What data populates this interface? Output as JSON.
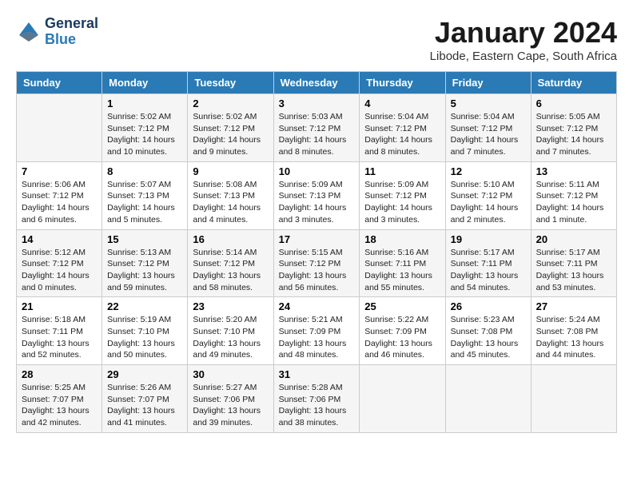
{
  "logo": {
    "text_general": "General",
    "text_blue": "Blue"
  },
  "title": "January 2024",
  "subtitle": "Libode, Eastern Cape, South Africa",
  "days_header": [
    "Sunday",
    "Monday",
    "Tuesday",
    "Wednesday",
    "Thursday",
    "Friday",
    "Saturday"
  ],
  "weeks": [
    [
      {
        "day": "",
        "sunrise": "",
        "sunset": "",
        "daylight": ""
      },
      {
        "day": "1",
        "sunrise": "Sunrise: 5:02 AM",
        "sunset": "Sunset: 7:12 PM",
        "daylight": "Daylight: 14 hours and 10 minutes."
      },
      {
        "day": "2",
        "sunrise": "Sunrise: 5:02 AM",
        "sunset": "Sunset: 7:12 PM",
        "daylight": "Daylight: 14 hours and 9 minutes."
      },
      {
        "day": "3",
        "sunrise": "Sunrise: 5:03 AM",
        "sunset": "Sunset: 7:12 PM",
        "daylight": "Daylight: 14 hours and 8 minutes."
      },
      {
        "day": "4",
        "sunrise": "Sunrise: 5:04 AM",
        "sunset": "Sunset: 7:12 PM",
        "daylight": "Daylight: 14 hours and 8 minutes."
      },
      {
        "day": "5",
        "sunrise": "Sunrise: 5:04 AM",
        "sunset": "Sunset: 7:12 PM",
        "daylight": "Daylight: 14 hours and 7 minutes."
      },
      {
        "day": "6",
        "sunrise": "Sunrise: 5:05 AM",
        "sunset": "Sunset: 7:12 PM",
        "daylight": "Daylight: 14 hours and 7 minutes."
      }
    ],
    [
      {
        "day": "7",
        "sunrise": "Sunrise: 5:06 AM",
        "sunset": "Sunset: 7:12 PM",
        "daylight": "Daylight: 14 hours and 6 minutes."
      },
      {
        "day": "8",
        "sunrise": "Sunrise: 5:07 AM",
        "sunset": "Sunset: 7:13 PM",
        "daylight": "Daylight: 14 hours and 5 minutes."
      },
      {
        "day": "9",
        "sunrise": "Sunrise: 5:08 AM",
        "sunset": "Sunset: 7:13 PM",
        "daylight": "Daylight: 14 hours and 4 minutes."
      },
      {
        "day": "10",
        "sunrise": "Sunrise: 5:09 AM",
        "sunset": "Sunset: 7:13 PM",
        "daylight": "Daylight: 14 hours and 3 minutes."
      },
      {
        "day": "11",
        "sunrise": "Sunrise: 5:09 AM",
        "sunset": "Sunset: 7:12 PM",
        "daylight": "Daylight: 14 hours and 3 minutes."
      },
      {
        "day": "12",
        "sunrise": "Sunrise: 5:10 AM",
        "sunset": "Sunset: 7:12 PM",
        "daylight": "Daylight: 14 hours and 2 minutes."
      },
      {
        "day": "13",
        "sunrise": "Sunrise: 5:11 AM",
        "sunset": "Sunset: 7:12 PM",
        "daylight": "Daylight: 14 hours and 1 minute."
      }
    ],
    [
      {
        "day": "14",
        "sunrise": "Sunrise: 5:12 AM",
        "sunset": "Sunset: 7:12 PM",
        "daylight": "Daylight: 14 hours and 0 minutes."
      },
      {
        "day": "15",
        "sunrise": "Sunrise: 5:13 AM",
        "sunset": "Sunset: 7:12 PM",
        "daylight": "Daylight: 13 hours and 59 minutes."
      },
      {
        "day": "16",
        "sunrise": "Sunrise: 5:14 AM",
        "sunset": "Sunset: 7:12 PM",
        "daylight": "Daylight: 13 hours and 58 minutes."
      },
      {
        "day": "17",
        "sunrise": "Sunrise: 5:15 AM",
        "sunset": "Sunset: 7:12 PM",
        "daylight": "Daylight: 13 hours and 56 minutes."
      },
      {
        "day": "18",
        "sunrise": "Sunrise: 5:16 AM",
        "sunset": "Sunset: 7:11 PM",
        "daylight": "Daylight: 13 hours and 55 minutes."
      },
      {
        "day": "19",
        "sunrise": "Sunrise: 5:17 AM",
        "sunset": "Sunset: 7:11 PM",
        "daylight": "Daylight: 13 hours and 54 minutes."
      },
      {
        "day": "20",
        "sunrise": "Sunrise: 5:17 AM",
        "sunset": "Sunset: 7:11 PM",
        "daylight": "Daylight: 13 hours and 53 minutes."
      }
    ],
    [
      {
        "day": "21",
        "sunrise": "Sunrise: 5:18 AM",
        "sunset": "Sunset: 7:11 PM",
        "daylight": "Daylight: 13 hours and 52 minutes."
      },
      {
        "day": "22",
        "sunrise": "Sunrise: 5:19 AM",
        "sunset": "Sunset: 7:10 PM",
        "daylight": "Daylight: 13 hours and 50 minutes."
      },
      {
        "day": "23",
        "sunrise": "Sunrise: 5:20 AM",
        "sunset": "Sunset: 7:10 PM",
        "daylight": "Daylight: 13 hours and 49 minutes."
      },
      {
        "day": "24",
        "sunrise": "Sunrise: 5:21 AM",
        "sunset": "Sunset: 7:09 PM",
        "daylight": "Daylight: 13 hours and 48 minutes."
      },
      {
        "day": "25",
        "sunrise": "Sunrise: 5:22 AM",
        "sunset": "Sunset: 7:09 PM",
        "daylight": "Daylight: 13 hours and 46 minutes."
      },
      {
        "day": "26",
        "sunrise": "Sunrise: 5:23 AM",
        "sunset": "Sunset: 7:08 PM",
        "daylight": "Daylight: 13 hours and 45 minutes."
      },
      {
        "day": "27",
        "sunrise": "Sunrise: 5:24 AM",
        "sunset": "Sunset: 7:08 PM",
        "daylight": "Daylight: 13 hours and 44 minutes."
      }
    ],
    [
      {
        "day": "28",
        "sunrise": "Sunrise: 5:25 AM",
        "sunset": "Sunset: 7:07 PM",
        "daylight": "Daylight: 13 hours and 42 minutes."
      },
      {
        "day": "29",
        "sunrise": "Sunrise: 5:26 AM",
        "sunset": "Sunset: 7:07 PM",
        "daylight": "Daylight: 13 hours and 41 minutes."
      },
      {
        "day": "30",
        "sunrise": "Sunrise: 5:27 AM",
        "sunset": "Sunset: 7:06 PM",
        "daylight": "Daylight: 13 hours and 39 minutes."
      },
      {
        "day": "31",
        "sunrise": "Sunrise: 5:28 AM",
        "sunset": "Sunset: 7:06 PM",
        "daylight": "Daylight: 13 hours and 38 minutes."
      },
      {
        "day": "",
        "sunrise": "",
        "sunset": "",
        "daylight": ""
      },
      {
        "day": "",
        "sunrise": "",
        "sunset": "",
        "daylight": ""
      },
      {
        "day": "",
        "sunrise": "",
        "sunset": "",
        "daylight": ""
      }
    ]
  ]
}
